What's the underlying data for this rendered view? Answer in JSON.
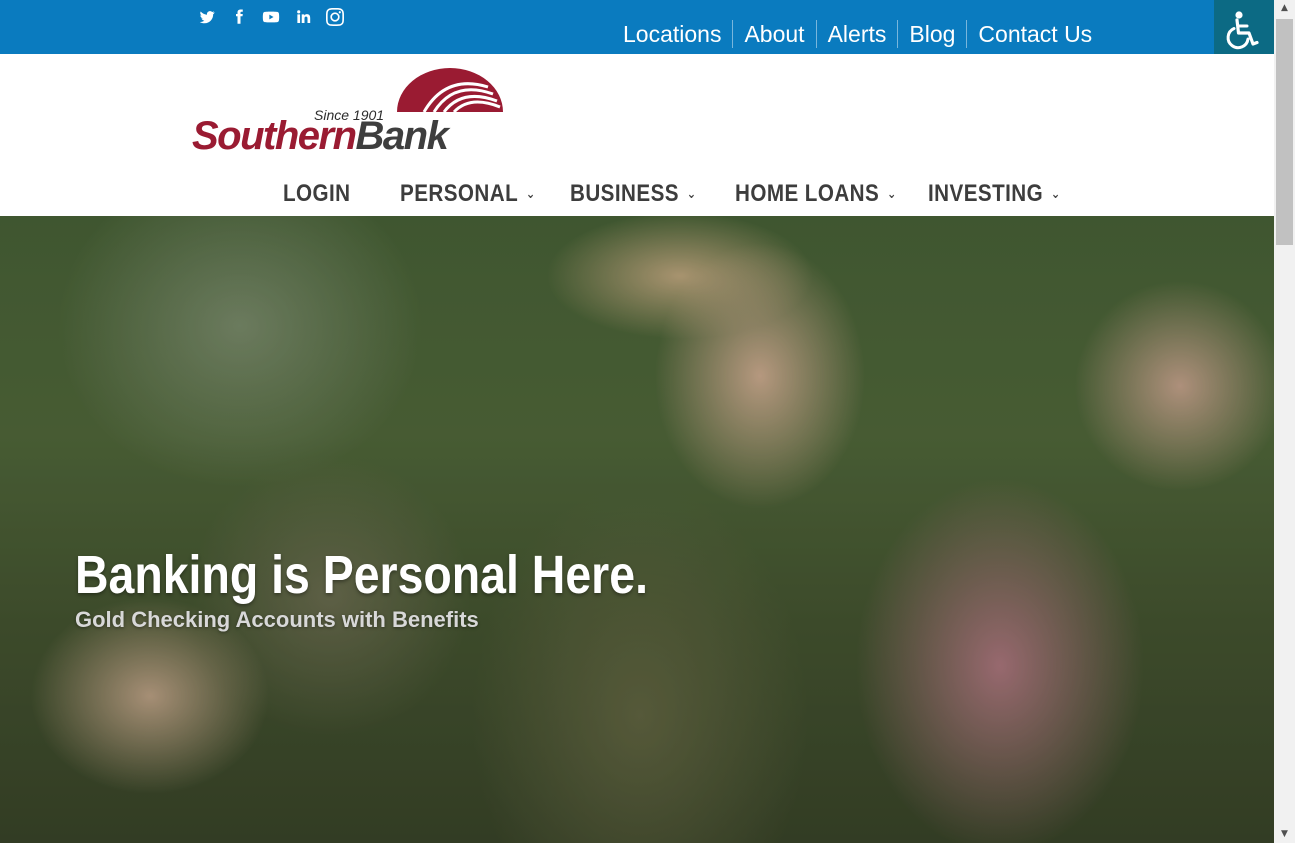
{
  "social": {
    "items": [
      {
        "name": "twitter",
        "label": "Twitter"
      },
      {
        "name": "facebook",
        "label": "Facebook"
      },
      {
        "name": "youtube",
        "label": "YouTube"
      },
      {
        "name": "linkedin",
        "label": "LinkedIn"
      },
      {
        "name": "instagram",
        "label": "Instagram"
      }
    ]
  },
  "toplinks": {
    "locations": "Locations",
    "about": "About",
    "alerts": "Alerts",
    "blog": "Blog",
    "contact": "Contact Us"
  },
  "accessibility": {
    "icon": "wheelchair-icon"
  },
  "logo": {
    "since": "Since 1901",
    "brand_part1": "Southern",
    "brand_part2": "Bank"
  },
  "nav": {
    "login": "LOGIN",
    "personal": "PERSONAL",
    "business": "BUSINESS",
    "home_loans": "HOME LOANS",
    "investing": "INVESTING",
    "caret": "⌄"
  },
  "hero": {
    "title": "Banking is Personal Here.",
    "subtitle": "Gold Checking Accounts with Benefits"
  },
  "colors": {
    "topbar": "#0a7bbf",
    "brand_red": "#9a1b32",
    "brand_gray": "#3e3e3e",
    "access_btn": "#0c6a84"
  }
}
